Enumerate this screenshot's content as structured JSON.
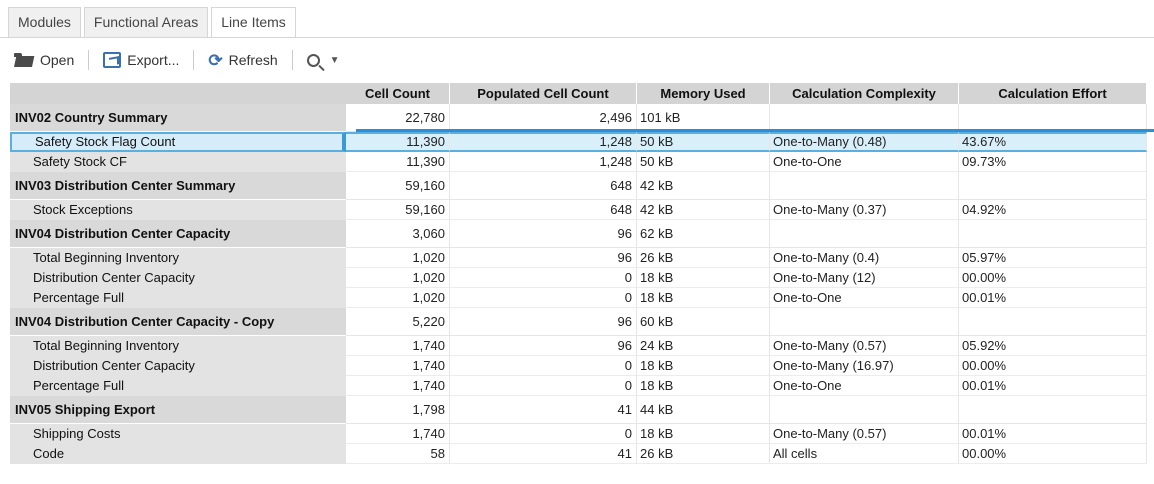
{
  "tabs": [
    "Modules",
    "Functional Areas",
    "Line Items"
  ],
  "active_tab": 2,
  "toolbar": {
    "open_label": "Open",
    "export_label": "Export...",
    "refresh_label": "Refresh"
  },
  "columns": [
    "Cell Count",
    "Populated Cell Count",
    "Memory Used",
    "Calculation Complexity",
    "Calculation Effort"
  ],
  "rows": [
    {
      "type": "module",
      "name": "INV02 Country Summary",
      "cell_count": "22,780",
      "populated": "2,496",
      "memory": "101 kB",
      "complexity": "",
      "effort": ""
    },
    {
      "type": "line",
      "selected": true,
      "name": "Safety Stock Flag Count",
      "cell_count": "11,390",
      "populated": "1,248",
      "memory": "50 kB",
      "complexity": "One-to-Many (0.48)",
      "effort": "43.67%"
    },
    {
      "type": "line",
      "name": "Safety Stock CF",
      "cell_count": "11,390",
      "populated": "1,248",
      "memory": "50 kB",
      "complexity": "One-to-One",
      "effort": "09.73%"
    },
    {
      "type": "module",
      "name": "INV03 Distribution Center Summary",
      "cell_count": "59,160",
      "populated": "648",
      "memory": "42 kB",
      "complexity": "",
      "effort": ""
    },
    {
      "type": "line",
      "name": "Stock Exceptions",
      "cell_count": "59,160",
      "populated": "648",
      "memory": "42 kB",
      "complexity": "One-to-Many (0.37)",
      "effort": "04.92%"
    },
    {
      "type": "module",
      "name": "INV04 Distribution Center Capacity",
      "cell_count": "3,060",
      "populated": "96",
      "memory": "62 kB",
      "complexity": "",
      "effort": ""
    },
    {
      "type": "line",
      "name": "Total Beginning Inventory",
      "cell_count": "1,020",
      "populated": "96",
      "memory": "26 kB",
      "complexity": "One-to-Many (0.4)",
      "effort": "05.97%"
    },
    {
      "type": "line",
      "name": "Distribution Center Capacity",
      "cell_count": "1,020",
      "populated": "0",
      "memory": "18 kB",
      "complexity": "One-to-Many (12)",
      "effort": "00.00%"
    },
    {
      "type": "line",
      "name": "Percentage Full",
      "cell_count": "1,020",
      "populated": "0",
      "memory": "18 kB",
      "complexity": "One-to-One",
      "effort": "00.01%"
    },
    {
      "type": "module",
      "name": "INV04 Distribution Center Capacity - Copy",
      "cell_count": "5,220",
      "populated": "96",
      "memory": "60 kB",
      "complexity": "",
      "effort": ""
    },
    {
      "type": "line",
      "name": "Total Beginning Inventory",
      "cell_count": "1,740",
      "populated": "96",
      "memory": "24 kB",
      "complexity": "One-to-Many (0.57)",
      "effort": "05.92%"
    },
    {
      "type": "line",
      "name": "Distribution Center Capacity",
      "cell_count": "1,740",
      "populated": "0",
      "memory": "18 kB",
      "complexity": "One-to-Many (16.97)",
      "effort": "00.00%"
    },
    {
      "type": "line",
      "name": "Percentage Full",
      "cell_count": "1,740",
      "populated": "0",
      "memory": "18 kB",
      "complexity": "One-to-One",
      "effort": "00.01%"
    },
    {
      "type": "module",
      "name": "INV05 Shipping Export",
      "cell_count": "1,798",
      "populated": "41",
      "memory": "44 kB",
      "complexity": "",
      "effort": ""
    },
    {
      "type": "line",
      "name": "Shipping Costs",
      "cell_count": "1,740",
      "populated": "0",
      "memory": "18 kB",
      "complexity": "One-to-Many (0.57)",
      "effort": "00.01%"
    },
    {
      "type": "line",
      "name": "Code",
      "cell_count": "58",
      "populated": "41",
      "memory": "26 kB",
      "complexity": "All cells",
      "effort": "00.00%"
    }
  ]
}
